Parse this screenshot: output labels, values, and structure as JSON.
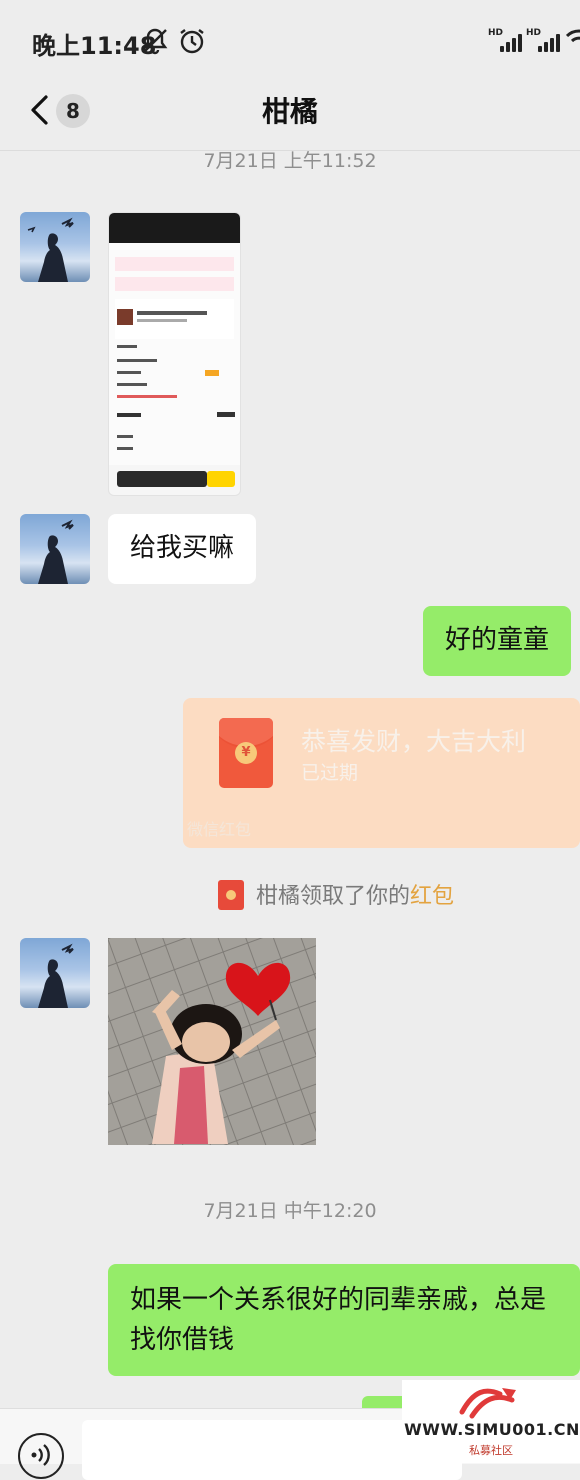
{
  "status_bar": {
    "time": "晚上11:48",
    "icons": [
      "mute-icon",
      "alarm-icon",
      "hd-signal-icon",
      "hd-signal-icon",
      "wifi-icon"
    ],
    "hd_label": "HD"
  },
  "nav": {
    "back_icon": "chevron-left-icon",
    "unread_count": "8",
    "title": "柑橘"
  },
  "messages": {
    "timestamp_1": "7月21日 上午11:52",
    "give_me": "给我买嘛",
    "ok": "好的童童",
    "red_packet": {
      "greeting": "恭喜发财，大吉大利",
      "status": "已过期",
      "footer": "微信红包",
      "coin_symbol": "¥"
    },
    "system_notice": {
      "text": "柑橘领取了你的",
      "link": "红包"
    },
    "timestamp_2": "7月21日 中午12:20",
    "question": "如果一个关系很好的同辈亲戚，总是找你借钱"
  },
  "watermark": {
    "url": "WWW.SIMU001.CN",
    "subtitle": "私募社区"
  },
  "colors": {
    "background": "#ededed",
    "green_bubble": "#95ec69",
    "red_packet_bg": "#fcdcc2",
    "notice_link": "#e3a340"
  }
}
